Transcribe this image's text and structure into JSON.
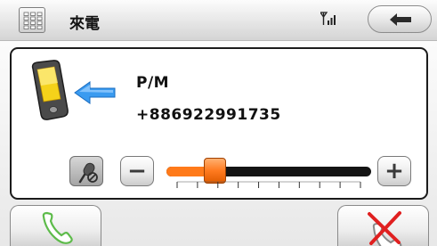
{
  "header": {
    "title": "來電",
    "keypad_icon": "keypad-icon",
    "signal_icon": "signal-strength-icon",
    "back_icon": "back-arrow-icon"
  },
  "call": {
    "caller_name": "P/M",
    "caller_number": "+886922991735",
    "phone_icon": "incoming-call-phone-icon"
  },
  "volume": {
    "mute_icon": "microphone-mute-icon",
    "minus_label": "−",
    "plus_label": "+",
    "level": 0.14,
    "tick_count": 10
  },
  "actions": {
    "answer_icon": "answer-handset-icon",
    "reject_icon": "reject-handset-icon"
  },
  "colors": {
    "slider_accent": "#ff7a1a",
    "arrow_blue": "#3a9bf0",
    "answer_green": "#5dbb4a",
    "reject_red": "#e02020"
  }
}
